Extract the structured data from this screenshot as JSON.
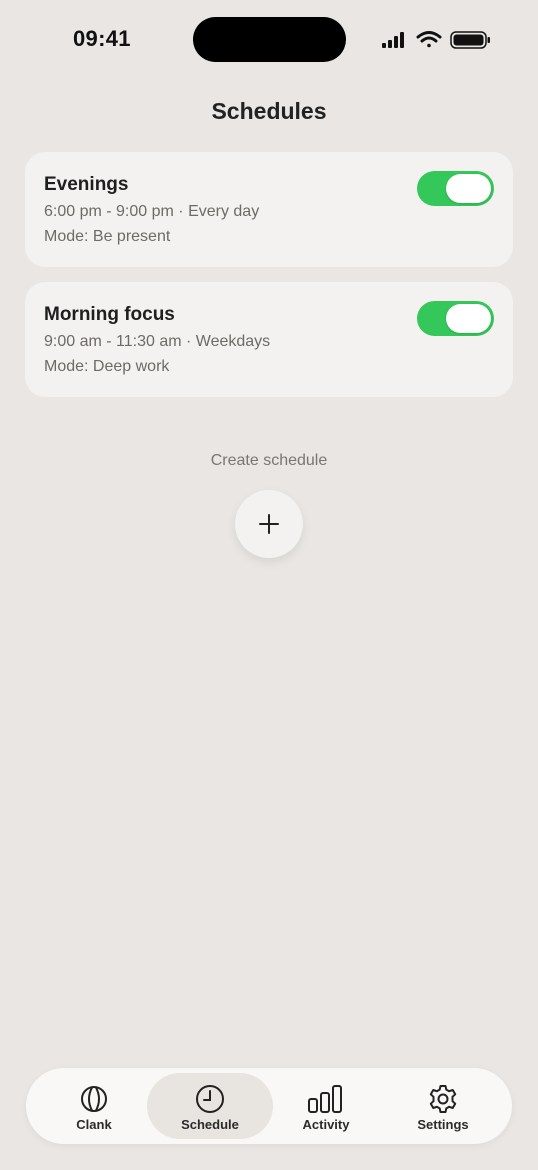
{
  "status_bar": {
    "time": "09:41"
  },
  "header": {
    "title": "Schedules"
  },
  "schedules": [
    {
      "name": "Evenings",
      "time_range": "6:00 pm - 9:00 pm · Every day",
      "mode": "Mode: Be present",
      "enabled": true
    },
    {
      "name": "Morning focus",
      "time_range": "9:00 am - 11:30 am · Weekdays",
      "mode": "Mode: Deep work",
      "enabled": true
    }
  ],
  "create": {
    "label": "Create schedule",
    "icon": "plus-icon"
  },
  "tabbar": {
    "tabs": [
      {
        "label": "Clank",
        "icon": "clank-icon",
        "active": false
      },
      {
        "label": "Schedule",
        "icon": "clock-icon",
        "active": true
      },
      {
        "label": "Activity",
        "icon": "bar-chart-icon",
        "active": false
      },
      {
        "label": "Settings",
        "icon": "gear-icon",
        "active": false
      }
    ]
  },
  "colors": {
    "background": "#E9E6E3",
    "card": "#F3F2F0",
    "toggle_on": "#34C75A",
    "tabbar": "#FAF8F6"
  }
}
